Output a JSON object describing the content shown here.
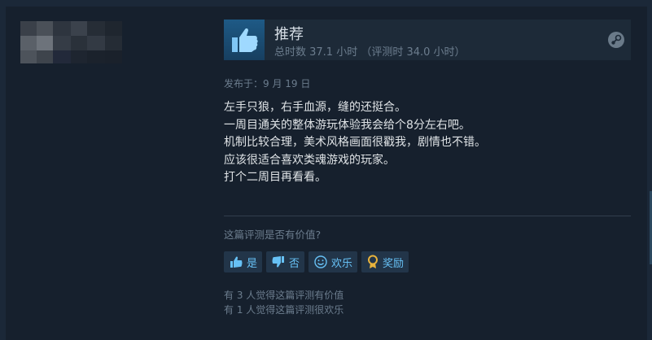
{
  "review": {
    "title": "推荐",
    "hours": "总时数 37.1 小时 （评测时 34.0 小时）",
    "posted": "发布于：9 月 19 日",
    "body": [
      "左手只狼，右手血源，缝的还挺合。",
      "一周目通关的整体游玩体验我会给个8分左右吧。",
      "机制比较合理，美术风格画面很戳我，剧情也不错。",
      "应该很适合喜欢类魂游戏的玩家。",
      "打个二周目再看看。"
    ]
  },
  "feedback": {
    "question": "这篇评测是否有价值?",
    "buttons": {
      "yes": "是",
      "no": "否",
      "funny": "欢乐",
      "award": "奖励"
    },
    "helpful_stat": "有 3 人觉得这篇评测有价值",
    "funny_stat": "有 1 人觉得这篇评测很欢乐"
  },
  "icons": [
    "thumbs-up-icon",
    "thumbs-down-icon",
    "smiley-icon",
    "award-icon",
    "steam-icon"
  ],
  "colors": {
    "page_bg": "#1b2838",
    "card_bg": "#16202d",
    "accent": "#67c1f5",
    "thumb_bg": "#1e5a86"
  }
}
